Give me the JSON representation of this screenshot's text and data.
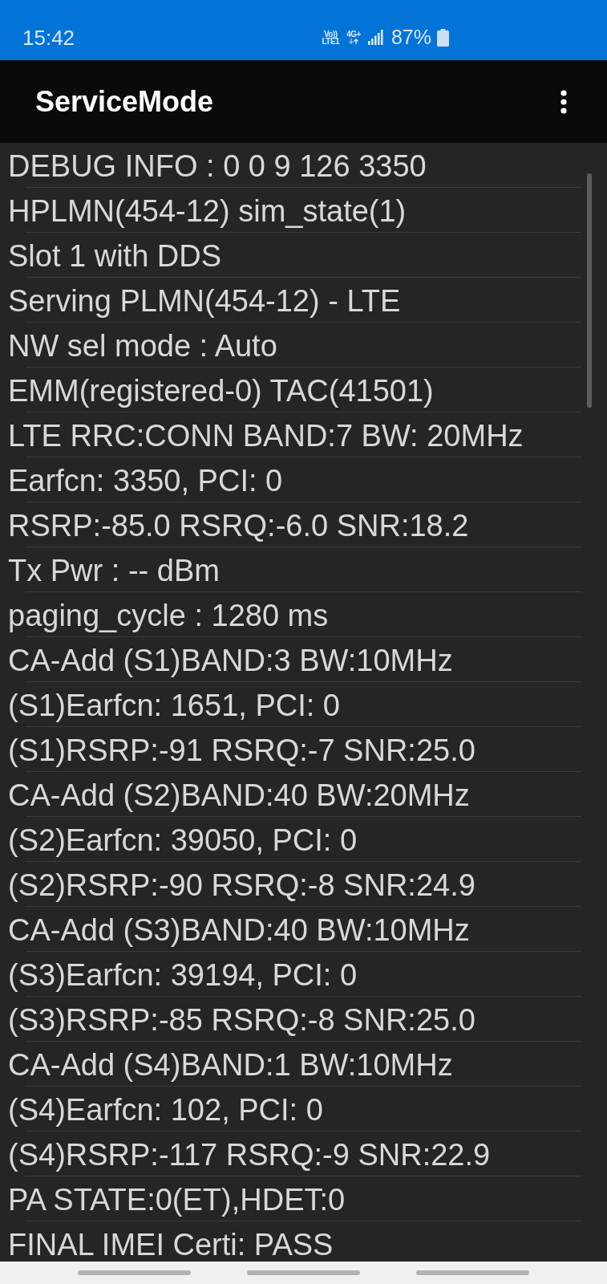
{
  "status_bar": {
    "time": "15:42",
    "volte_top": "Vo))",
    "volte_bottom": "LTE1",
    "network_type": "4G+",
    "battery": "87%"
  },
  "app_bar": {
    "title": "ServiceMode"
  },
  "info_lines": [
    "DEBUG INFO : 0 0 9 126 3350",
    "HPLMN(454-12) sim_state(1)",
    "Slot 1 with DDS",
    "Serving PLMN(454-12) - LTE",
    "NW sel mode : Auto",
    "EMM(registered-0) TAC(41501)",
    "LTE RRC:CONN BAND:7 BW: 20MHz",
    "Earfcn: 3350, PCI: 0",
    "RSRP:-85.0 RSRQ:-6.0 SNR:18.2",
    "Tx Pwr : -- dBm",
    "paging_cycle : 1280 ms",
    "CA-Add (S1)BAND:3 BW:10MHz",
    "(S1)Earfcn: 1651, PCI: 0",
    "(S1)RSRP:-91 RSRQ:-7 SNR:25.0",
    "CA-Add (S2)BAND:40 BW:20MHz",
    "(S2)Earfcn: 39050, PCI: 0",
    "(S2)RSRP:-90 RSRQ:-8 SNR:24.9",
    "CA-Add (S3)BAND:40 BW:10MHz",
    "(S3)Earfcn: 39194, PCI: 0",
    "(S3)RSRP:-85 RSRQ:-8 SNR:25.0",
    "CA-Add (S4)BAND:1 BW:10MHz",
    "(S4)Earfcn: 102, PCI: 0",
    "(S4)RSRP:-117 RSRQ:-9 SNR:22.9",
    "PA STATE:0(ET),HDET:0",
    "FINAL IMEI Certi: PASS"
  ]
}
